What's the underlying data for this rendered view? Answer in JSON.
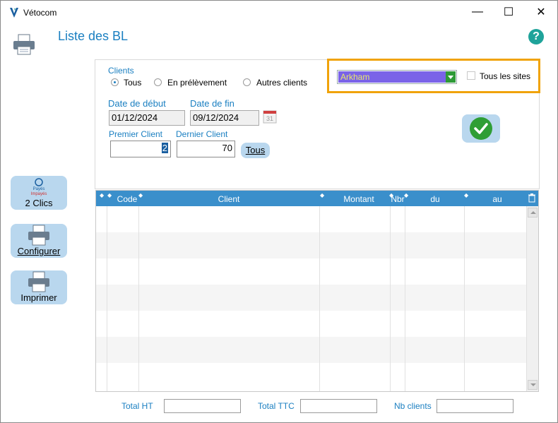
{
  "window": {
    "app_title": "Vétocom",
    "minimize": "—",
    "maximize": "☐",
    "close": "✕"
  },
  "page": {
    "title": "Liste des BL",
    "help": "?"
  },
  "sidebar": {
    "two_clicks": {
      "icon_top": "Payés",
      "icon_bottom": "Impayés",
      "label": "2 Clics"
    },
    "configure": {
      "label": "Configurer"
    },
    "print": {
      "label": "Imprimer"
    }
  },
  "filters": {
    "clients_label": "Clients",
    "options": [
      "Tous",
      "En prélèvement",
      "Autres clients"
    ],
    "selected_option": "Tous",
    "site_value": "Arkham",
    "all_sites_label": "Tous les sites",
    "all_sites_checked": false,
    "start_date_label": "Date de début",
    "start_date": "01/12/2024",
    "end_date_label": "Date de fin",
    "end_date": "09/12/2024",
    "calendar_day": "31",
    "first_client_label": "Premier Client",
    "first_client": "2",
    "last_client_label": "Dernier Client",
    "last_client": "70",
    "all_button": "Tous"
  },
  "table": {
    "columns": [
      "",
      "Code",
      "Client",
      "Montant",
      "Nbr",
      "du",
      "au"
    ],
    "rows": []
  },
  "totals": {
    "ht_label": "Total HT",
    "ht_value": "",
    "ttc_label": "Total TTC",
    "ttc_value": "",
    "nb_clients_label": "Nb clients",
    "nb_clients_value": ""
  },
  "colors": {
    "accent": "#1a7fc1",
    "highlight_border": "#f0a30a",
    "header_bg": "#3a8fcb",
    "button_bg": "#b9d7ee",
    "ok_green": "#2f9e35"
  }
}
